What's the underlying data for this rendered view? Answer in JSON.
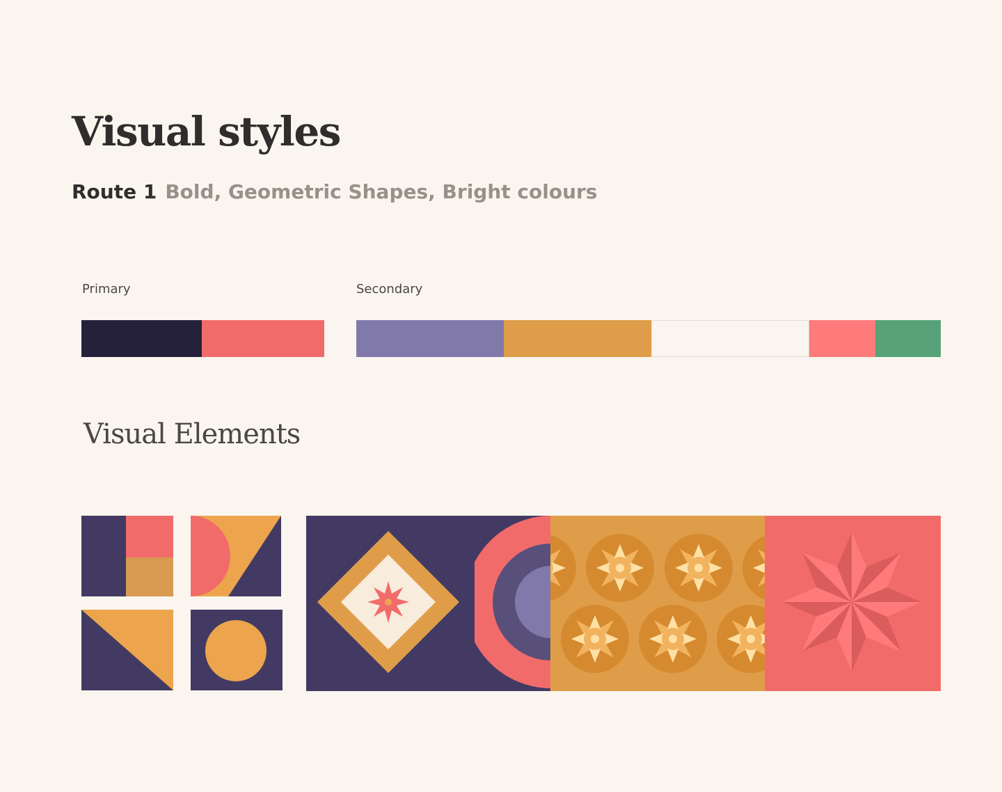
{
  "page": {
    "title": "Visual styles",
    "route_label": "Route 1",
    "route_description": "Bold, Geometric Shapes, Bright colours"
  },
  "palette": {
    "primary_label": "Primary",
    "secondary_label": "Secondary",
    "primary": [
      "#26213a",
      "#f26b6b"
    ],
    "secondary": [
      "#8079aa",
      "#df9d4a",
      "#faf6ef",
      "#ff7b7b",
      "#57a278"
    ]
  },
  "visual_elements": {
    "heading": "Visual Elements",
    "tiles": [
      "split-square-tile",
      "half-circle-triangle-tile",
      "diagonal-triangle-tile",
      "circle-tile",
      "diamond-star-tile",
      "concentric-arc-tile",
      "sun-pattern-tile",
      "eight-point-star-tile"
    ],
    "colors": {
      "navy": "#423a63",
      "deep_navy": "#58507a",
      "lavender": "#8079aa",
      "coral": "#f26b6b",
      "salmon": "#ff7b7b",
      "dark_coral": "#db5c5c",
      "mustard": "#df9d4a",
      "orange": "#eca54c",
      "ochre": "#d99a52",
      "dark_orange": "#d68a2f",
      "peach": "#f2b35f",
      "cream": "#f8ecdc",
      "light_cream": "#ffe1a6"
    }
  }
}
